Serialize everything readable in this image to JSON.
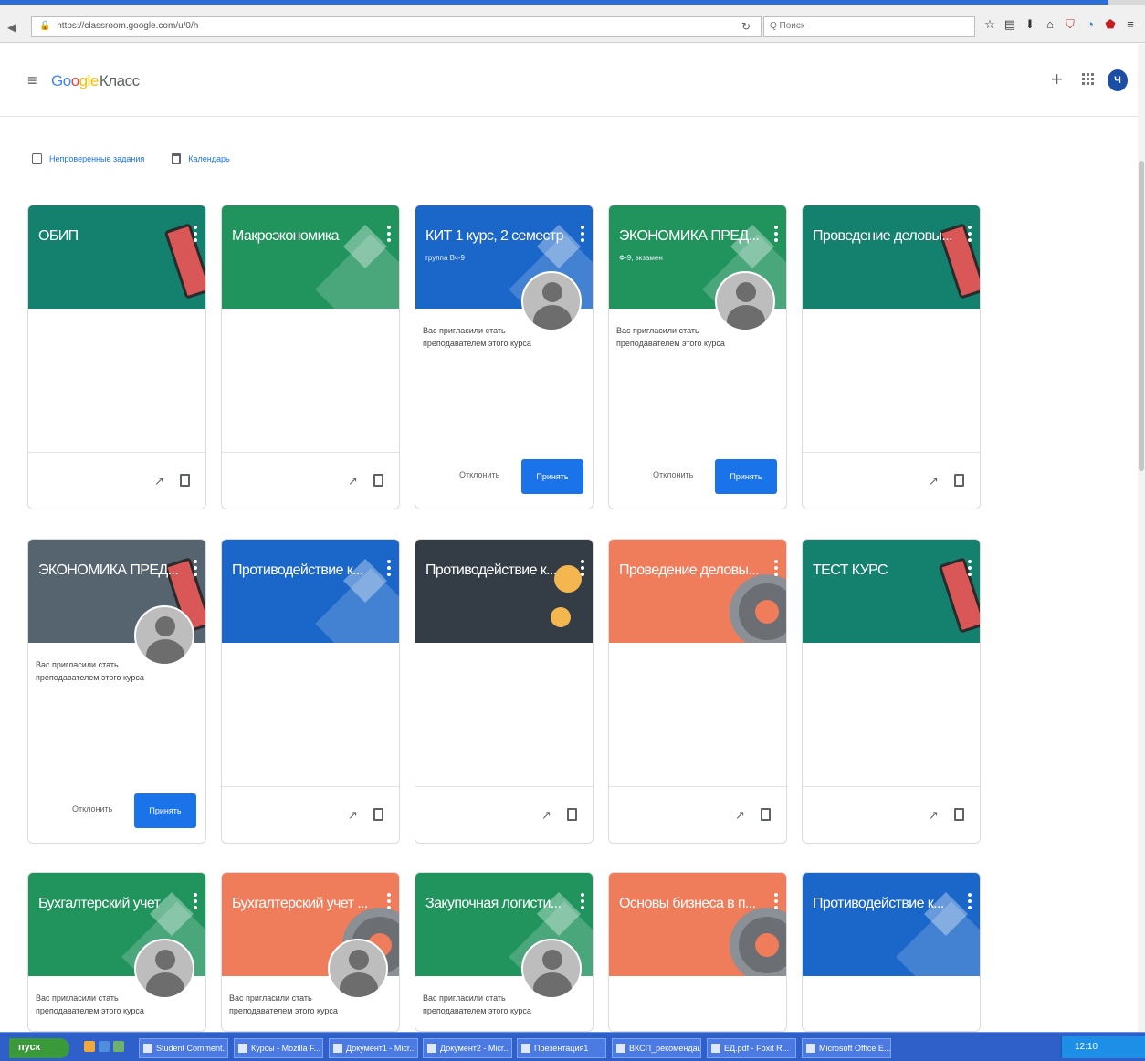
{
  "browser": {
    "url": "https://classroom.google.com/u/0/h",
    "search_placeholder": "Q Поиск",
    "toolbar_icons": [
      "star-icon",
      "bookmark-icon",
      "download-icon",
      "home-icon",
      "shield-icon",
      "sync-icon",
      "extension-icon",
      "menu-icon"
    ]
  },
  "app": {
    "brand": {
      "g1": "Go",
      "g2": "o",
      "g3": "gle",
      "cls": "Класс"
    },
    "avatar_initial": "Ч"
  },
  "links": {
    "unverified": "Непроверенные задания",
    "calendar": "Календарь"
  },
  "labels": {
    "decline": "Отклонить",
    "accept": "Принять",
    "invite": "Вас пригласили стать преподавателем этого курса"
  },
  "courses": [
    {
      "title": "ОБИП",
      "color": "#14806e",
      "deco": "phone",
      "invited": false
    },
    {
      "title": "Макроэкономика",
      "color": "#21945e",
      "deco": "shapes",
      "invited": false
    },
    {
      "title": "КИТ 1 курс, 2 семестр",
      "subtitle": "группа Вч-9",
      "color": "#1a66c9",
      "deco": "shapes",
      "invited": true
    },
    {
      "title": "ЭКОНОМИКА ПРЕД...",
      "subtitle": "Ф-9, экзамен",
      "color": "#21945e",
      "deco": "shapes",
      "invited": true
    },
    {
      "title": "Проведение деловы...",
      "color": "#14806e",
      "deco": "phone",
      "invited": false
    },
    {
      "title": "ЭКОНОМИКА ПРЕД...",
      "color": "#566470",
      "deco": "phone",
      "invited": true
    },
    {
      "title": "Противодействие к...",
      "color": "#1a66c9",
      "deco": "shapes",
      "invited": false
    },
    {
      "title": "Противодействие к...",
      "color": "#343d46",
      "deco": "circles",
      "invited": false
    },
    {
      "title": "Проведение деловы...",
      "color": "#ef7c5a",
      "deco": "gear",
      "invited": false
    },
    {
      "title": "ТЕСТ КУРС",
      "color": "#14806e",
      "deco": "phone",
      "invited": false
    },
    {
      "title": "Бухгалтерский учет",
      "color": "#21945e",
      "deco": "shapes",
      "invited": true
    },
    {
      "title": "Бухгалтерский учет ...",
      "color": "#ef7c5a",
      "deco": "gear",
      "invited": true
    },
    {
      "title": "Закупочная логисти...",
      "color": "#21945e",
      "deco": "shapes",
      "invited": true
    },
    {
      "title": "Основы бизнеса в п...",
      "color": "#ef7c5a",
      "deco": "gear",
      "invited": false
    },
    {
      "title": "Противодействие к...",
      "color": "#1a66c9",
      "deco": "shapes",
      "invited": false
    }
  ],
  "taskbar": {
    "start": "пуск",
    "items": [
      "Student Comment...",
      "Курсы - Mozilla F...",
      "Документ1 - Micr...",
      "Документ2 - Micr...",
      "Презентация1",
      "ВКСП_рекомендации",
      "ЕД.pdf - Foxit R...",
      "Microsoft Office E..."
    ],
    "clock": "12:10"
  }
}
